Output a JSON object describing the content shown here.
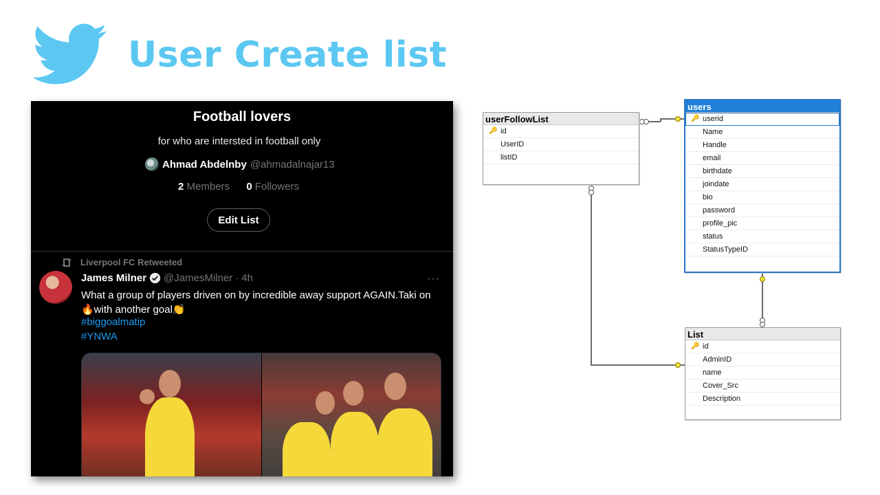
{
  "slide": {
    "title": "User Create list"
  },
  "twitter": {
    "list_name": "Football lovers",
    "list_description": "for who are intersted in football only",
    "owner_name": "Ahmad Abdelnby",
    "owner_handle": "@ahmadalnajar13",
    "members_count": "2",
    "members_label": "Members",
    "followers_count": "0",
    "followers_label": "Followers",
    "edit_button": "Edit List",
    "tweet": {
      "retweeted_by": "Liverpool FC Retweeted",
      "author_name": "James Milner",
      "author_handle": "@JamesMilner",
      "separator": "·",
      "time": "4h",
      "more": "···",
      "text": "What a group of players driven on by incredible away support AGAIN.Taki on 🔥with another goal👏",
      "hashtags": [
        "#biggoalmatip",
        "#YNWA"
      ]
    }
  },
  "diagram": {
    "tables": [
      {
        "name": "userFollowList",
        "columns": [
          "id",
          "UserID",
          "listID"
        ],
        "key_column": "id"
      },
      {
        "name": "users",
        "columns": [
          "userid",
          "Name",
          "Handle",
          "email",
          "birthdate",
          "joindate",
          "bio",
          "password",
          "profile_pic",
          "status",
          "StatusTypeID"
        ],
        "key_column": "userid",
        "selected": true
      },
      {
        "name": "List",
        "columns": [
          "id",
          "AdminID",
          "name",
          "Cover_Src",
          "Description"
        ],
        "key_column": "id"
      }
    ]
  },
  "colors": {
    "title": "#5cc8f2",
    "twitter_bg": "#000000",
    "hashtag": "#1d9bf0",
    "selected_table": "#1e80d8"
  },
  "icons": [
    "twitter-bird-icon",
    "retweet-icon",
    "verified-icon",
    "key-icon",
    "more-icon"
  ]
}
